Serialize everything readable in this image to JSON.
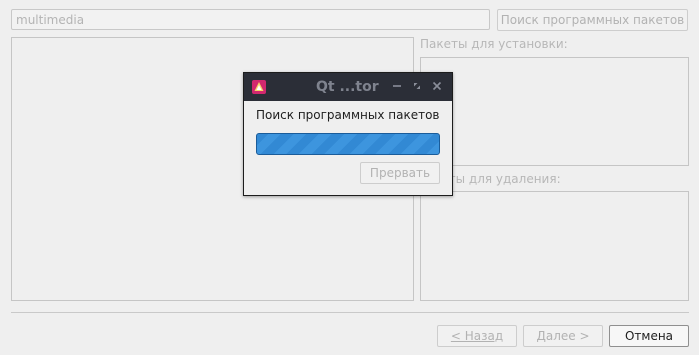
{
  "wizard": {
    "search_value": "multimedia",
    "search_button": "Поиск программных пакетов",
    "install_label": "Пакеты для установки:",
    "remove_label": "кеты для удаления:",
    "back_button": "< Назад",
    "next_button": "Далее >",
    "cancel_button": "Отмена"
  },
  "dialog": {
    "title": "Qt ...tor",
    "message": "Поиск программных пакетов",
    "abort_button": "Прервать",
    "progress_state": "busy"
  },
  "icons": {
    "app": "qt-maintenance-tool-icon",
    "minimize": "minimize-icon",
    "restore": "restore-icon",
    "close": "close-icon"
  },
  "colors": {
    "titlebar": "#2b2e37",
    "progress": "#3d95de",
    "background": "#efefef"
  }
}
